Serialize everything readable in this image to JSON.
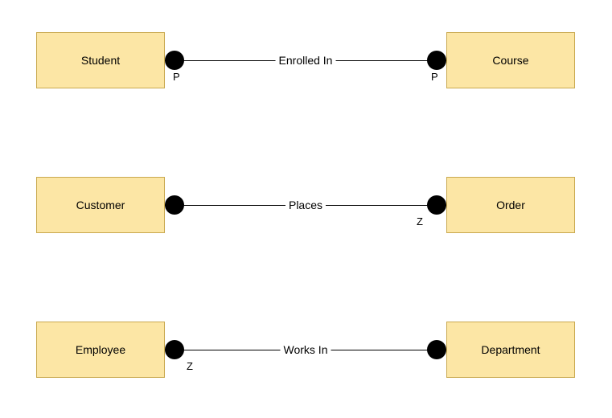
{
  "rows": [
    {
      "left": {
        "label": "Student"
      },
      "right": {
        "label": "Course"
      },
      "relation": {
        "label": "Enrolled In"
      },
      "leftCard": {
        "label": "P"
      },
      "rightCard": {
        "label": "P"
      }
    },
    {
      "left": {
        "label": "Customer"
      },
      "right": {
        "label": "Order"
      },
      "relation": {
        "label": "Places"
      },
      "leftCard": null,
      "rightCard": {
        "label": "Z"
      }
    },
    {
      "left": {
        "label": "Employee"
      },
      "right": {
        "label": "Department"
      },
      "relation": {
        "label": "Works In"
      },
      "leftCard": {
        "label": "Z"
      },
      "rightCard": null
    }
  ]
}
